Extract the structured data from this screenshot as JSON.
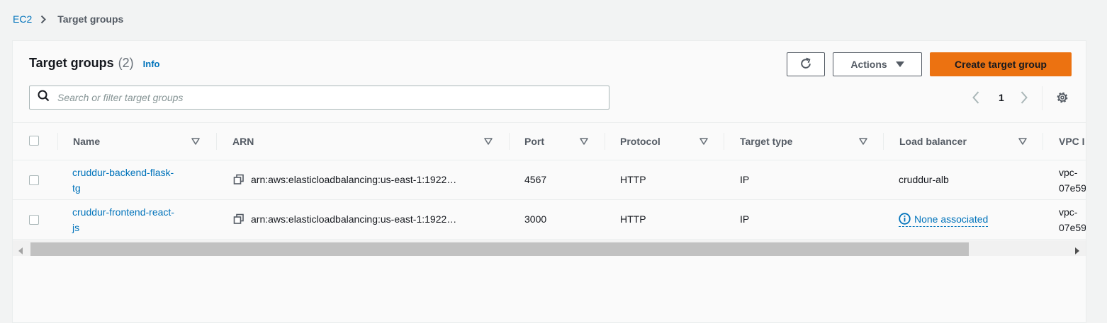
{
  "breadcrumb": {
    "root": "EC2",
    "current": "Target groups"
  },
  "header": {
    "title": "Target groups",
    "count": "(2)",
    "info": "Info"
  },
  "buttons": {
    "actions": "Actions",
    "create": "Create target group"
  },
  "search": {
    "placeholder": "Search or filter target groups",
    "value": ""
  },
  "pagination": {
    "current_page": "1"
  },
  "table": {
    "columns": [
      "Name",
      "ARN",
      "Port",
      "Protocol",
      "Target type",
      "Load balancer",
      "VPC I"
    ],
    "rows": [
      {
        "name_line1": "cruddur-backend-flask-",
        "name_line2": "tg",
        "arn": "arn:aws:elasticloadbalancing:us-east-1:1922…",
        "port": "4567",
        "protocol": "HTTP",
        "target_type": "IP",
        "load_balancer": "cruddur-alb",
        "vpc_line1": "vpc-",
        "vpc_line2": "07e59"
      },
      {
        "name_line1": "cruddur-frontend-react-",
        "name_line2": "js",
        "arn": "arn:aws:elasticloadbalancing:us-east-1:1922…",
        "port": "3000",
        "protocol": "HTTP",
        "target_type": "IP",
        "load_balancer": "None associated",
        "vpc_line1": "vpc-",
        "vpc_line2": "07e59"
      }
    ]
  },
  "colors": {
    "link": "#0073bb",
    "primary_button": "#ec7211",
    "text": "#16191f",
    "muted": "#545b64"
  },
  "icons": [
    "chevron-right-icon",
    "refresh-icon",
    "caret-down-icon",
    "search-icon",
    "chevron-left-icon",
    "chevron-right-icon",
    "gear-icon",
    "sort-icon",
    "copy-icon",
    "info-icon",
    "scroll-left-icon",
    "scroll-right-icon"
  ]
}
